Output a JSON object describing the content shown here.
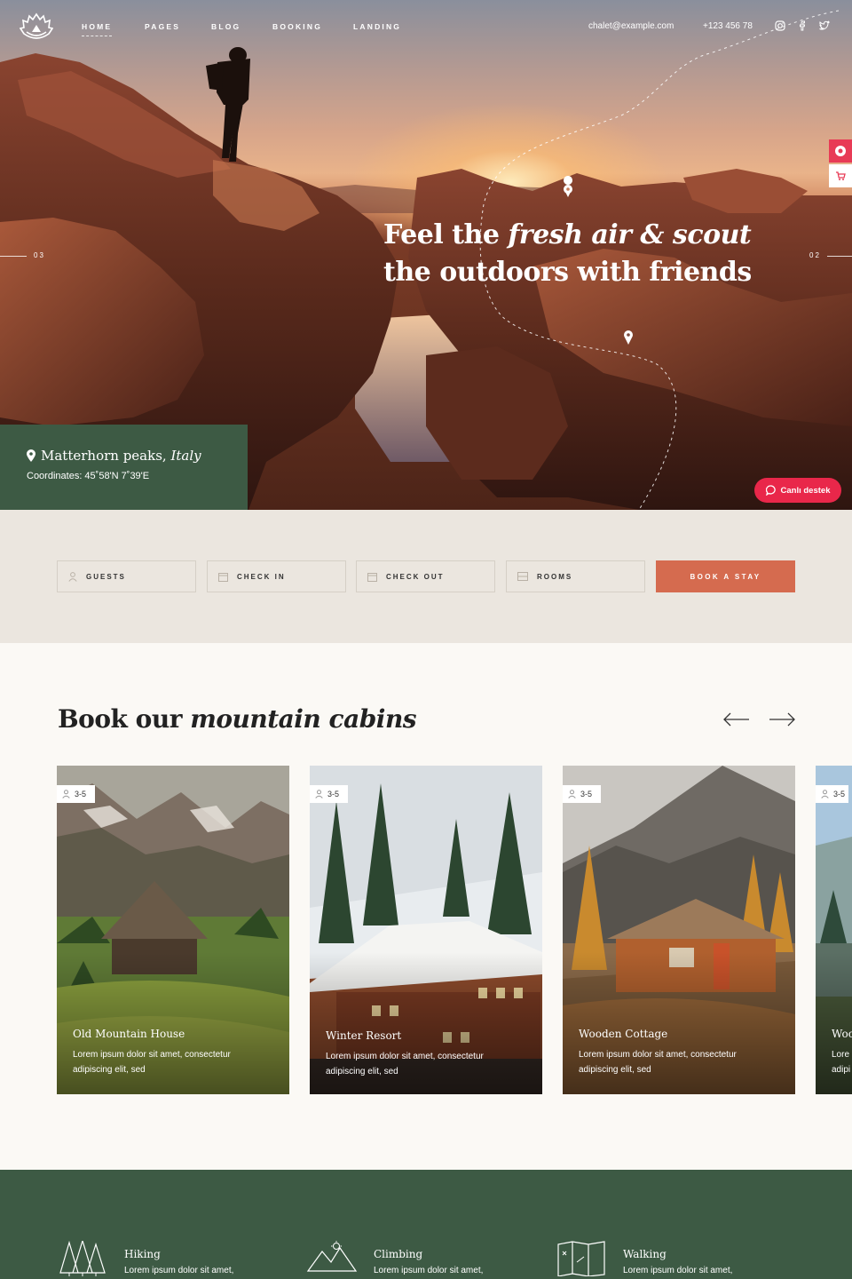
{
  "nav": {
    "items": [
      "HOME",
      "PAGES",
      "BLOG",
      "BOOKING",
      "LANDING"
    ],
    "email": "chalet@example.com",
    "phone": "+123 456 78"
  },
  "hero": {
    "title_part1": "Feel the ",
    "title_italic": "fresh air & scout",
    "title_part2": "the outdoors with friends",
    "slide_prev": "03",
    "slide_next": "02",
    "location_name": "Matterhorn peaks,",
    "location_country": "Italy",
    "coordinates": "Coordinates: 45˚58'N 7˚39'E"
  },
  "chat": {
    "label": "Canlı destek"
  },
  "booking": {
    "guests": "GUESTS",
    "check_in": "CHECK IN",
    "check_out": "CHECK OUT",
    "rooms": "ROOMS",
    "button": "BOOK A STAY"
  },
  "cabins": {
    "title_plain": "Book our ",
    "title_italic": "mountain cabins",
    "items": [
      {
        "guests": "3-5",
        "name": "Old Mountain House",
        "desc": "Lorem ipsum dolor sit amet, consectetur adipiscing elit, sed"
      },
      {
        "guests": "3-5",
        "name": "Winter Resort",
        "desc": "Lorem ipsum dolor sit amet, consectetur adipiscing elit, sed"
      },
      {
        "guests": "3-5",
        "name": "Wooden Cottage",
        "desc": "Lorem ipsum dolor sit amet, consectetur adipiscing elit, sed"
      },
      {
        "guests": "3-5",
        "name": "Woo",
        "desc": "Lore adipi"
      }
    ]
  },
  "features": [
    {
      "title": "Hiking",
      "desc": "Lorem ipsum dolor sit amet,"
    },
    {
      "title": "Climbing",
      "desc": "Lorem ipsum dolor sit amet,"
    },
    {
      "title": "Walking",
      "desc": "Lorem ipsum dolor sit amet,"
    }
  ],
  "colors": {
    "green": "#3d5a44",
    "terracotta": "#d56b4f",
    "chat_red": "#e9274a",
    "beige": "#ebe6df"
  }
}
